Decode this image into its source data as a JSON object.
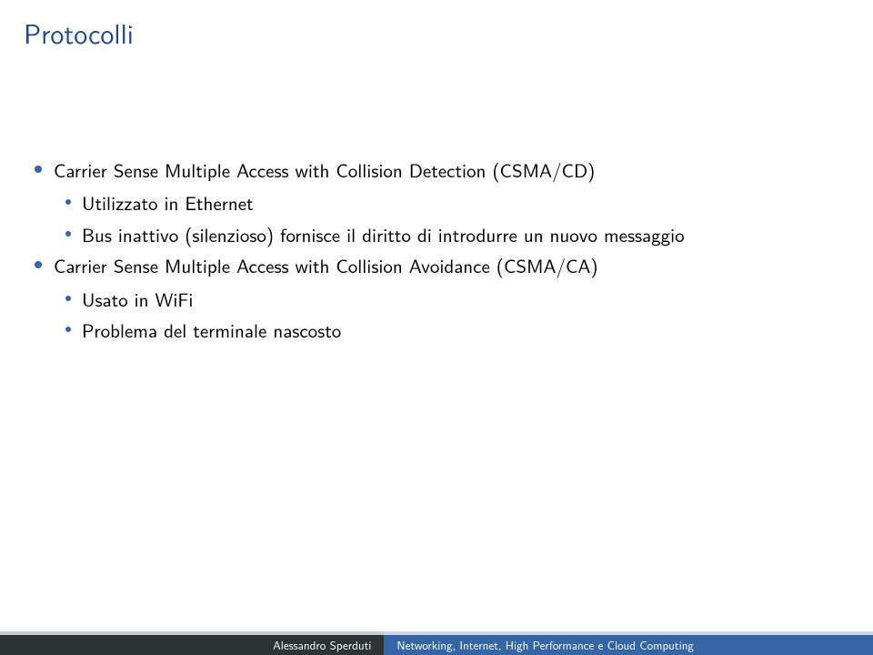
{
  "title": "Protocolli",
  "bullets": [
    {
      "level": 1,
      "text": "Carrier Sense Multiple Access with Collision Detection (CSMA/CD)"
    },
    {
      "level": 2,
      "text": "Utilizzato in Ethernet"
    },
    {
      "level": 2,
      "text": "Bus inattivo (silenzioso) fornisce il diritto di introdurre un nuovo messaggio"
    },
    {
      "level": 1,
      "text": "Carrier Sense Multiple Access with Collision Avoidance (CSMA/CA)"
    },
    {
      "level": 2,
      "text": "Usato in WiFi"
    },
    {
      "level": 2,
      "text": "Problema del terminale nascosto"
    }
  ],
  "footer": {
    "author": "Alessandro Sperduti",
    "course": "Networking, Internet, High Performance e Cloud Computing"
  }
}
